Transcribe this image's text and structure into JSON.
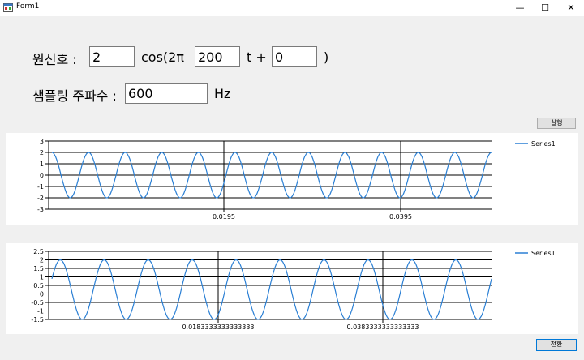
{
  "window": {
    "title": "Form1",
    "minimize": "—",
    "maximize": "☐",
    "close": "✕"
  },
  "signal": {
    "label": "원신호 :",
    "amplitude": "2",
    "cos_label": "cos(2π",
    "frequency": "200",
    "t_label": "t +",
    "phase": "0",
    "close_paren": ")"
  },
  "sampling": {
    "label": "샘플링 주파수 :",
    "value": "600",
    "unit": "Hz"
  },
  "buttons": {
    "run": "실행",
    "transform": "전환"
  },
  "chart_data": [
    {
      "type": "line",
      "series": [
        {
          "name": "Series1",
          "color": "#2a7fd4",
          "amplitude": 2,
          "cycles": 12,
          "phase": 0
        }
      ],
      "y_ticks": [
        "3",
        "2",
        "1",
        "0",
        "-1",
        "-2",
        "-3"
      ],
      "x_labels": [
        "0.0195",
        "0.0395"
      ],
      "ylim": [
        -3,
        3
      ],
      "grid": true,
      "legend": "top-right"
    },
    {
      "type": "line",
      "series": [
        {
          "name": "Series1",
          "color": "#2a7fd4",
          "amplitude": 1.75,
          "offset": 0.25,
          "cycles": 10,
          "phase": -1.2
        }
      ],
      "y_ticks": [
        "2.5",
        "2",
        "1.5",
        "1",
        "0.5",
        "0",
        "-0.5",
        "-1",
        "-1.5"
      ],
      "x_labels": [
        "0.0183333333333333",
        "0.0383333333333333"
      ],
      "ylim": [
        -1.5,
        2.5
      ],
      "grid": true,
      "legend": "top-right"
    }
  ]
}
